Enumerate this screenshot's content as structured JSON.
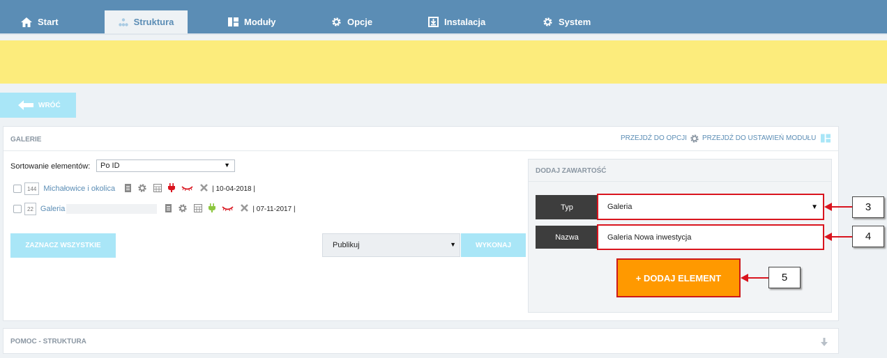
{
  "nav": {
    "tabs": [
      {
        "label": "Start",
        "icon": "home-icon"
      },
      {
        "label": "Struktura",
        "icon": "sitemap-icon"
      },
      {
        "label": "Moduły",
        "icon": "modules-icon"
      },
      {
        "label": "Opcje",
        "icon": "gear-icon"
      },
      {
        "label": "Instalacja",
        "icon": "install-icon"
      },
      {
        "label": "System",
        "icon": "gear-icon"
      }
    ],
    "active_tab": "Struktura"
  },
  "back_label": "WRÓĆ",
  "gallery_panel": {
    "title": "GALERIE",
    "link_options": "PRZEJDŹ DO OPCJI",
    "link_module_settings": "PRZEJDŹ DO USTAWIEŃ MODUŁU",
    "sort_label": "Sortowanie elementów:",
    "sort_value": "Po ID",
    "items": [
      {
        "id": "144",
        "name": "Michałowice i okolica",
        "date": "| 10-04-2018 |",
        "plug_color": "#d9141e"
      },
      {
        "id": "22",
        "name": "Galeria",
        "date": "| 07-11-2017 |",
        "plug_color": "#8cc63f"
      }
    ],
    "select_all_label": "ZAZNACZ WSZYSTKIE",
    "action_value": "Publikuj",
    "execute_label": "WYKONAJ"
  },
  "add_content": {
    "title": "DODAJ ZAWARTOŚĆ",
    "type_label": "Typ",
    "type_value": "Galeria",
    "name_label": "Nazwa",
    "name_value": "Galeria Nowa inwestycja",
    "add_button_label": "+ DODAJ ELEMENT"
  },
  "callouts": [
    "3",
    "4",
    "5"
  ],
  "help_panel": {
    "title": "POMOC - STRUKTURA"
  },
  "colors": {
    "nav": "#5b8db5",
    "banner": "#fcec7c",
    "cyan_button": "#a9e6f7",
    "orange_button": "#ff9900",
    "highlight_red": "#d9141e"
  }
}
